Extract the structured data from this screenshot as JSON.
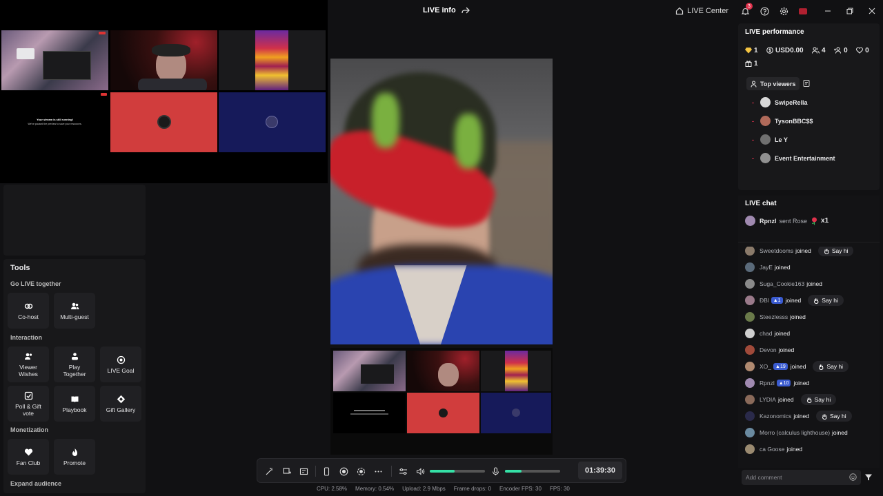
{
  "titlebar": {
    "title": "LIVE info",
    "live_center": "LIVE Center",
    "notification_count": "3"
  },
  "grid": {
    "offline_title": "Your stream is still running!",
    "offline_sub": "We've paused the preview to save your resources."
  },
  "tools": {
    "title": "Tools",
    "sections": {
      "go_live": "Go LIVE together",
      "interaction": "Interaction",
      "monetization": "Monetization",
      "expand": "Expand audience"
    },
    "cohost": "Co-host",
    "multiguest": "Multi-guest",
    "viewer_wishes": "Viewer Wishes",
    "play_together": "Play Together",
    "live_goal": "LIVE Goal",
    "poll_gift_vote": "Poll & Gift vote",
    "playbook": "Playbook",
    "gift_gallery": "Gift Gallery",
    "fan_club": "Fan Club",
    "promote": "Promote"
  },
  "controls": {
    "timer": "01:39:30",
    "speaker_level": 0.45,
    "mic_level": 0.3
  },
  "stats": {
    "cpu": "CPU:  2.58%",
    "memory": "Memory:  0.54%",
    "upload": "Upload:  2.9 Mbps",
    "frame_drops": "Frame drops:  0",
    "encoder_fps": "Encoder FPS:  30",
    "fps": "FPS:  30"
  },
  "performance": {
    "title": "LIVE performance",
    "diamonds": "1",
    "usd": "USD0.00",
    "viewers": "4",
    "new_followers": "0",
    "likes": "0",
    "gifters": "1",
    "top_viewers_tab": "Top viewers",
    "top_viewers": [
      {
        "rank": "-",
        "name": "SwipeRella",
        "color": "#d8d8d8"
      },
      {
        "rank": "-",
        "name": "TysonBBC$$",
        "color": "#b06a5a"
      },
      {
        "rank": "-",
        "name": "Le Y",
        "color": "#707070"
      },
      {
        "rank": "-",
        "name": "Event Entertainment",
        "color": "#909090"
      }
    ]
  },
  "chat": {
    "title": "LIVE chat",
    "pinned_user": "Rpnzl",
    "pinned_action": "sent Rose",
    "pinned_count": "x1",
    "say_hi": "Say hi",
    "joined": "joined",
    "messages": [
      {
        "user": "Sweetdooms",
        "badge": "",
        "say_hi": true,
        "color": "#8a7a6a"
      },
      {
        "user": "JayE",
        "badge": "",
        "say_hi": false,
        "color": "#5a6a7a"
      },
      {
        "user": "Suga_Cookie163",
        "badge": "",
        "say_hi": false,
        "color": "#8a8a8a"
      },
      {
        "user": "ÐBl",
        "badge": "1",
        "say_hi": true,
        "color": "#9a7a8a"
      },
      {
        "user": "Steezlesss",
        "badge": "",
        "say_hi": false,
        "color": "#6a7a4a"
      },
      {
        "user": "chad",
        "badge": "",
        "say_hi": false,
        "color": "#cfcfcf"
      },
      {
        "user": "Devon",
        "badge": "",
        "say_hi": false,
        "color": "#a04a3a"
      },
      {
        "user": "XO_",
        "badge": "19",
        "say_hi": true,
        "color": "#b08a70"
      },
      {
        "user": "Rpnzl",
        "badge": "10",
        "say_hi": false,
        "color": "#a08ab0"
      },
      {
        "user": "LYDIA",
        "badge": "",
        "say_hi": true,
        "color": "#8a6a5a"
      },
      {
        "user": "Kazonomics",
        "badge": "",
        "say_hi": true,
        "color": "#2a2a4a"
      },
      {
        "user": "Morro (calculus lighthouse)",
        "badge": "",
        "say_hi": false,
        "color": "#6a8aa0"
      },
      {
        "user": "ca Goose",
        "badge": "",
        "say_hi": false,
        "color": "#9a8a70"
      }
    ],
    "comment_placeholder": "Add comment"
  }
}
